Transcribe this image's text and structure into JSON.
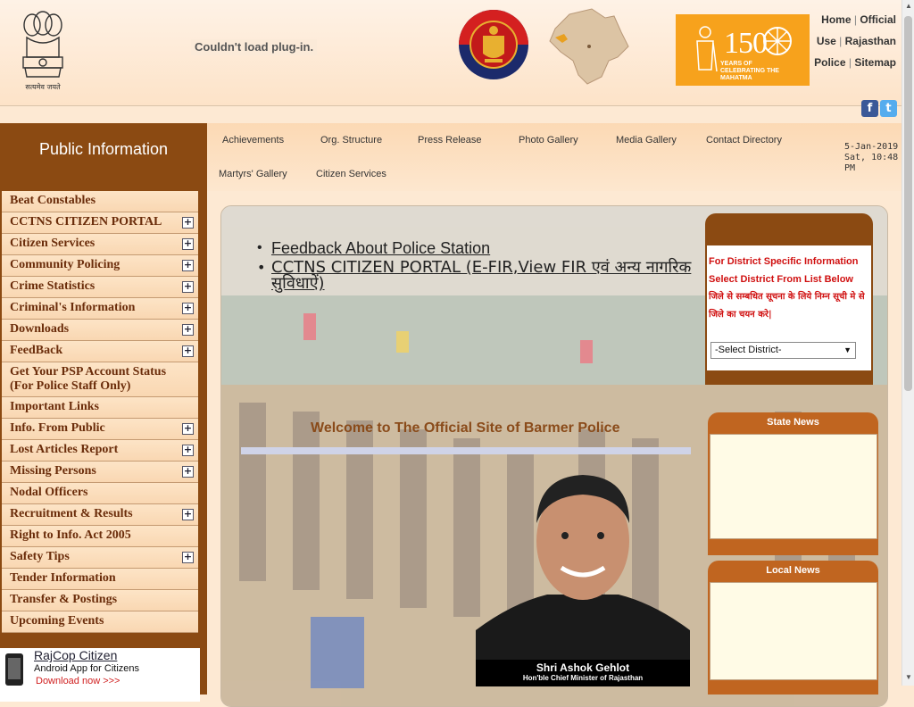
{
  "header": {
    "emblem_caption": "सत्यमेव जयते",
    "plugin_message": "Couldn't load plug-in.",
    "celebration": {
      "number": "150",
      "text": "YEARS OF CELEBRATING THE MAHATMA"
    },
    "top_links": [
      "Home",
      "Official Use",
      "Rajasthan Police",
      "Sitemap"
    ],
    "social": {
      "facebook": "f",
      "twitter": "t"
    }
  },
  "sidebar": {
    "title": "Public Information",
    "items": [
      {
        "label": "Beat Constables",
        "expandable": false
      },
      {
        "label": "CCTNS CITIZEN PORTAL",
        "expandable": true
      },
      {
        "label": "Citizen Services",
        "expandable": true
      },
      {
        "label": "Community Policing",
        "expandable": true
      },
      {
        "label": "Crime Statistics",
        "expandable": true
      },
      {
        "label": "Criminal's Information",
        "expandable": true
      },
      {
        "label": "Downloads",
        "expandable": true
      },
      {
        "label": "FeedBack",
        "expandable": true
      },
      {
        "label": "Get Your PSP Account Status (For Police Staff Only)",
        "expandable": false
      },
      {
        "label": "Important Links",
        "expandable": false
      },
      {
        "label": "Info. From Public",
        "expandable": true
      },
      {
        "label": "Lost Articles Report",
        "expandable": true
      },
      {
        "label": "Missing Persons",
        "expandable": true
      },
      {
        "label": "Nodal Officers",
        "expandable": false
      },
      {
        "label": "Recruitment & Results",
        "expandable": true
      },
      {
        "label": "Right to Info. Act 2005",
        "expandable": false
      },
      {
        "label": "Safety Tips",
        "expandable": true
      },
      {
        "label": "Tender Information",
        "expandable": false
      },
      {
        "label": "Transfer & Postings",
        "expandable": false
      },
      {
        "label": "Upcoming Events",
        "expandable": false
      }
    ],
    "plus_glyph": "+",
    "app": {
      "title": "RajCop Citizen",
      "subtitle": "Android App for Citizens",
      "download": "Download now >>>"
    }
  },
  "nav": {
    "row1": [
      "Achievements",
      "Org. Structure",
      "Press Release",
      "Photo Gallery",
      "Media Gallery",
      "Contact Directory"
    ],
    "row2": [
      "Martyrs' Gallery",
      "Citizen Services"
    ],
    "date": "5-Jan-2019",
    "time": "Sat, 10:48 PM"
  },
  "main": {
    "bullets": [
      "Feedback About Police Station",
      "CCTNS CITIZEN PORTAL (E-FIR,View FIR एवं अन्य नागरिक सुविधाऐं)"
    ],
    "welcome": "Welcome to The Official Site of Barmer Police",
    "cm_name": "Shri Ashok Gehlot",
    "cm_role": "Hon'ble Chief Minister of Rajasthan"
  },
  "district": {
    "instruction": "For District Specific Information Select District From List Below",
    "instruction_hindi": "जिले से सम्बधित सूचना के लिये निम्न सूची मे से जिले का चयन करे|",
    "select_value": "-Select District-",
    "arrow": "▼"
  },
  "news": {
    "state_title": "State News",
    "local_title": "Local News"
  },
  "scrollbar": {
    "up": "▲",
    "down": "▼"
  }
}
